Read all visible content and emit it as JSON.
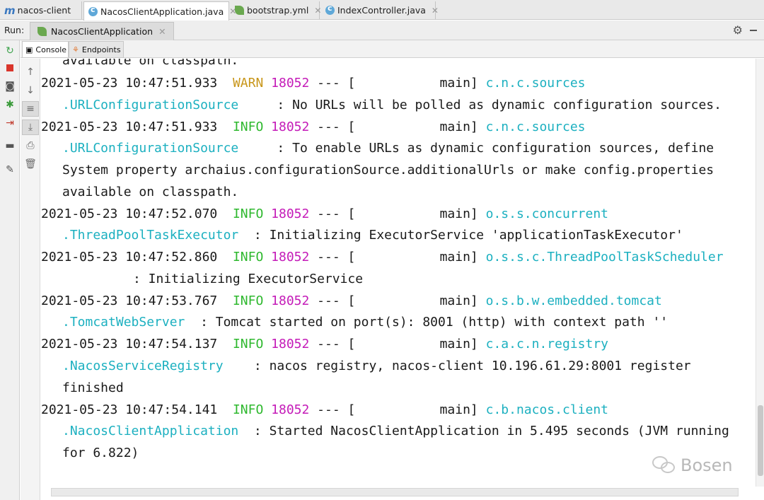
{
  "editor_tabs": [
    {
      "label": "nacos-client",
      "icon": "module-icon"
    },
    {
      "label": "NacosClientApplication.java",
      "icon": "class-icon"
    },
    {
      "label": "bootstrap.yml",
      "icon": "spring-config-icon"
    },
    {
      "label": "IndexController.java",
      "icon": "class-icon"
    }
  ],
  "run": {
    "label": "Run:",
    "tab_label": "NacosClientApplication"
  },
  "console_tabs": [
    "Console",
    "Endpoints"
  ],
  "console": {
    "partial_first_line": "available on classpath.",
    "entries": [
      {
        "timestamp": "2021-05-23 10:47:51.933",
        "level": "WARN",
        "pid": "18052",
        "sep": "---",
        "thread": "[           main]",
        "logger": "c.n.c.sources",
        "class_line": ".URLConfigurationSource",
        "message": "     : No URLs will be polled as dynamic configuration sources."
      },
      {
        "timestamp": "2021-05-23 10:47:51.933",
        "level": "INFO",
        "pid": "18052",
        "sep": "---",
        "thread": "[           main]",
        "logger": "c.n.c.sources",
        "class_line": ".URLConfigurationSource",
        "message": "     : To enable URLs as dynamic configuration sources, define",
        "continuation": [
          "System property archaius.configurationSource.additionalUrls or make config.properties",
          "available on classpath."
        ]
      },
      {
        "timestamp": "2021-05-23 10:47:52.070",
        "level": "INFO",
        "pid": "18052",
        "sep": "---",
        "thread": "[           main]",
        "logger": "o.s.s.concurrent",
        "class_line": ".ThreadPoolTaskExecutor",
        "message": "  : Initializing ExecutorService 'applicationTaskExecutor'"
      },
      {
        "timestamp": "2021-05-23 10:47:52.860",
        "level": "INFO",
        "pid": "18052",
        "sep": "---",
        "thread": "[           main]",
        "logger": "o.s.s.c.ThreadPoolTaskScheduler",
        "message": ": Initializing ExecutorService"
      },
      {
        "timestamp": "2021-05-23 10:47:53.767",
        "level": "INFO",
        "pid": "18052",
        "sep": "---",
        "thread": "[           main]",
        "logger": "o.s.b.w.embedded.tomcat",
        "class_line": ".TomcatWebServer",
        "message": "  : Tomcat started on port(s): 8001 (http) with context path ''"
      },
      {
        "timestamp": "2021-05-23 10:47:54.137",
        "level": "INFO",
        "pid": "18052",
        "sep": "---",
        "thread": "[           main]",
        "logger": "c.a.c.n.registry",
        "class_line": ".NacosServiceRegistry",
        "message": "    : nacos registry, nacos-client 10.196.61.29:8001 register",
        "continuation": [
          "finished"
        ]
      },
      {
        "timestamp": "2021-05-23 10:47:54.141",
        "level": "INFO",
        "pid": "18052",
        "sep": "---",
        "thread": "[           main]",
        "logger": "c.b.nacos.client",
        "class_line": ".NacosClientApplication",
        "message": "  : Started NacosClientApplication in 5.495 seconds (JVM running",
        "continuation": [
          "for 6.822)"
        ]
      }
    ]
  },
  "watermark": "Bosen",
  "colors": {
    "warn": "#c8961a",
    "info": "#2eb82e",
    "pid": "#c41bb8",
    "logger": "#1cb0c0"
  }
}
